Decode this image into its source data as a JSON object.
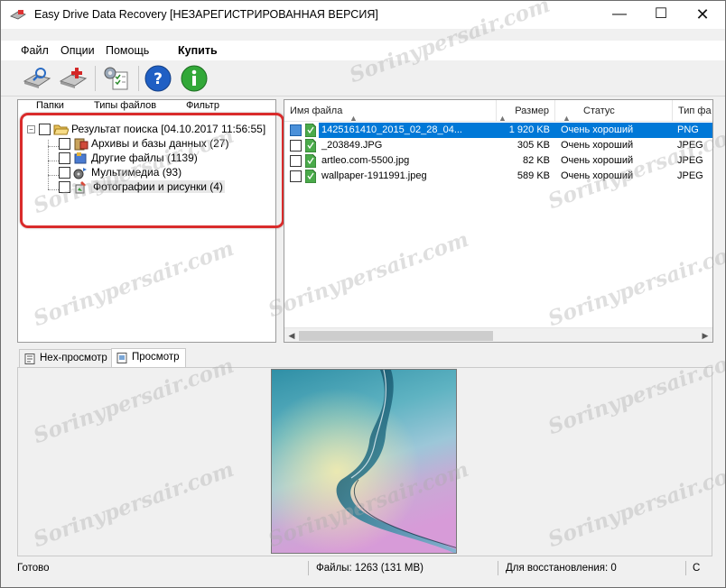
{
  "window": {
    "title": "Easy Drive Data Recovery [НЕЗАРЕГИСТРИРОВАННАЯ ВЕРСИЯ]",
    "minimize_glyph": "—",
    "maximize_glyph": "☐",
    "close_glyph": "✕"
  },
  "menu": {
    "items": [
      "Файл",
      "Опции",
      "Помощь",
      "Купить"
    ]
  },
  "toolbar": {
    "buttons": [
      "scan-drive-icon",
      "add-drive-icon",
      "settings-checklist-icon",
      "help-icon",
      "info-icon"
    ]
  },
  "left_panel": {
    "tabs": [
      "Папки",
      "Типы файлов",
      "Фильтр"
    ],
    "tree": {
      "root_label": "Результат поиска [04.10.2017 11:56:55]",
      "children": [
        "Архивы и базы данных (27)",
        "Другие файлы (1139)",
        "Мультимедиа (93)",
        "Фотографии и рисунки (4)"
      ]
    }
  },
  "file_list": {
    "columns": [
      "Имя файла",
      "Размер",
      "Статус",
      "Тип фа"
    ],
    "rows": [
      {
        "name": "1425161410_2015_02_28_04...",
        "size": "1 920 KB",
        "status": "Очень хороший",
        "type": "PNG",
        "selected": true
      },
      {
        "name": "_203849.JPG",
        "size": "305 KB",
        "status": "Очень хороший",
        "type": "JPEG",
        "selected": false
      },
      {
        "name": "artleo.com-5500.jpg",
        "size": "82 KB",
        "status": "Очень хороший",
        "type": "JPEG",
        "selected": false
      },
      {
        "name": "wallpaper-1911991.jpeg",
        "size": "589 KB",
        "status": "Очень хороший",
        "type": "JPEG",
        "selected": false
      }
    ]
  },
  "bottom_tabs": [
    "Hex-просмотр",
    "Просмотр"
  ],
  "status_bar": {
    "ready": "Готово",
    "files": "Файлы: 1263 (131 MB)",
    "to_recover": "Для восстановления: 0",
    "extra": "С"
  },
  "watermark": "Sorinypersair.com",
  "colors": {
    "selection": "#0078d7",
    "highlight_box": "#d92b2b",
    "window_bg": "#f0f0f0"
  }
}
